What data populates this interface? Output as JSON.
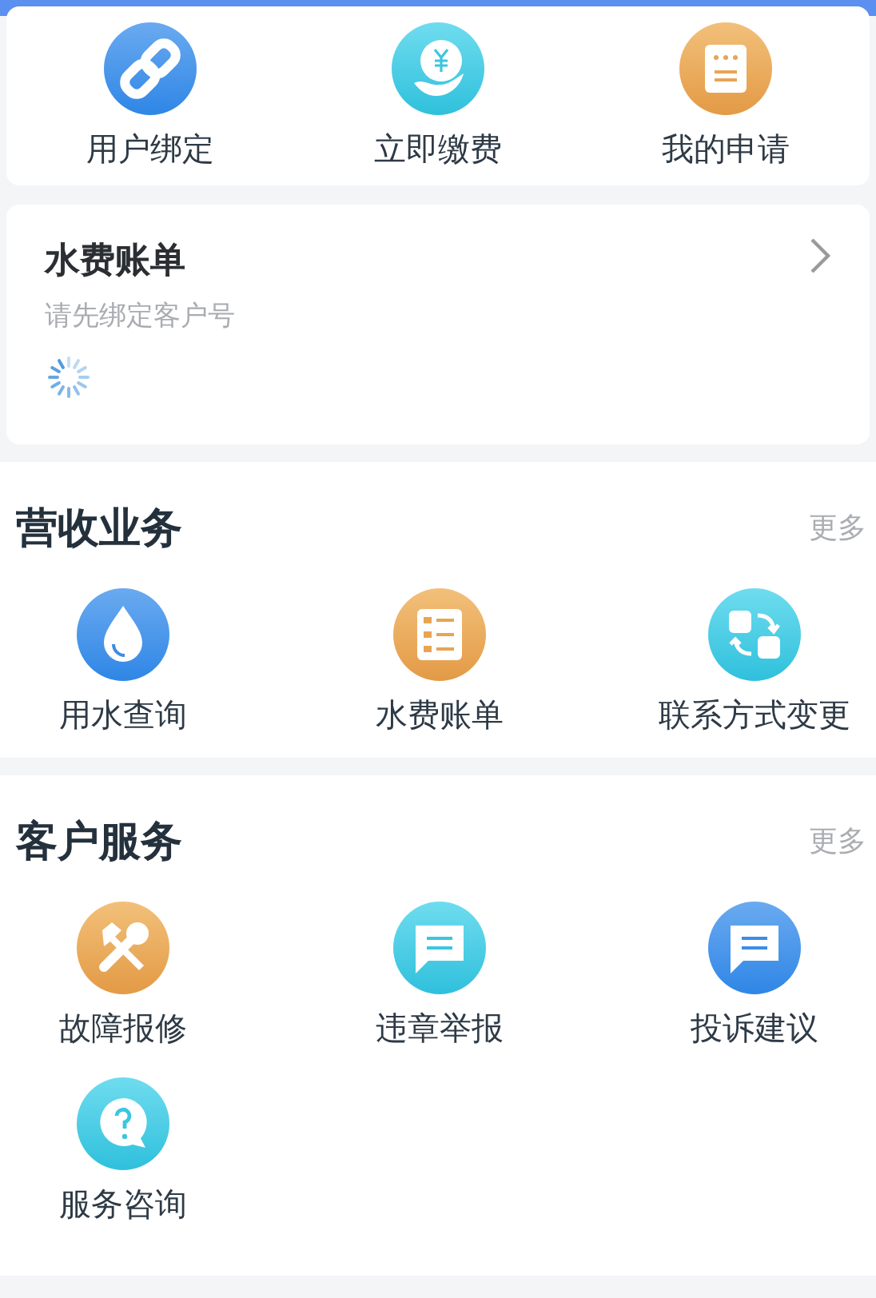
{
  "top_actions": [
    {
      "label": "用户绑定"
    },
    {
      "label": "立即缴费"
    },
    {
      "label": "我的申请"
    }
  ],
  "bill_card": {
    "title": "水费账单",
    "subtitle": "请先绑定客户号"
  },
  "sections": [
    {
      "title": "营收业务",
      "more": "更多",
      "items": [
        {
          "label": "用水查询"
        },
        {
          "label": "水费账单"
        },
        {
          "label": "联系方式变更"
        }
      ]
    },
    {
      "title": "客户服务",
      "more": "更多",
      "items": [
        {
          "label": "故障报修"
        },
        {
          "label": "违章举报"
        },
        {
          "label": "投诉建议"
        },
        {
          "label": "服务咨询"
        }
      ]
    }
  ]
}
